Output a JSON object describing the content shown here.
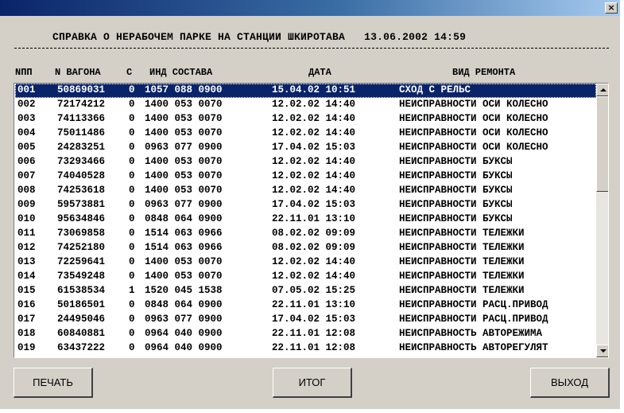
{
  "window": {
    "close_symbol": "×"
  },
  "report": {
    "title": "СПРАВКА О НЕРАБОЧЕМ ПАРКЕ НА СТАНЦИИ ШКИРОТАВА",
    "date": "13.06.2002 14:59"
  },
  "columns": {
    "npp": "NПП",
    "wagon": "N ВАГОНА",
    "c": "С",
    "train": "ИНД СОСТАВА",
    "date": "ДАТА",
    "repair": "ВИД РЕМОНТА"
  },
  "rows": [
    {
      "npp": "001",
      "wagon": "50869031",
      "c": "0",
      "train": "1057 088 0900",
      "date": "15.04.02 10:51",
      "repair": "СХОД С РЕЛЬС",
      "selected": true
    },
    {
      "npp": "002",
      "wagon": "72174212",
      "c": "0",
      "train": "1400 053 0070",
      "date": "12.02.02 14:40",
      "repair": "НЕИСПРАВНОСТИ ОСИ КОЛЕСНО"
    },
    {
      "npp": "003",
      "wagon": "74113366",
      "c": "0",
      "train": "1400 053 0070",
      "date": "12.02.02 14:40",
      "repair": "НЕИСПРАВНОСТИ ОСИ КОЛЕСНО"
    },
    {
      "npp": "004",
      "wagon": "75011486",
      "c": "0",
      "train": "1400 053 0070",
      "date": "12.02.02 14:40",
      "repair": "НЕИСПРАВНОСТИ ОСИ КОЛЕСНО"
    },
    {
      "npp": "005",
      "wagon": "24283251",
      "c": "0",
      "train": "0963 077 0900",
      "date": "17.04.02 15:03",
      "repair": "НЕИСПРАВНОСТИ ОСИ КОЛЕСНО"
    },
    {
      "npp": "006",
      "wagon": "73293466",
      "c": "0",
      "train": "1400 053 0070",
      "date": "12.02.02 14:40",
      "repair": "НЕИСПРАВНОСТИ БУКСЫ"
    },
    {
      "npp": "007",
      "wagon": "74040528",
      "c": "0",
      "train": "1400 053 0070",
      "date": "12.02.02 14:40",
      "repair": "НЕИСПРАВНОСТИ БУКСЫ"
    },
    {
      "npp": "008",
      "wagon": "74253618",
      "c": "0",
      "train": "1400 053 0070",
      "date": "12.02.02 14:40",
      "repair": "НЕИСПРАВНОСТИ БУКСЫ"
    },
    {
      "npp": "009",
      "wagon": "59573881",
      "c": "0",
      "train": "0963 077 0900",
      "date": "17.04.02 15:03",
      "repair": "НЕИСПРАВНОСТИ БУКСЫ"
    },
    {
      "npp": "010",
      "wagon": "95634846",
      "c": "0",
      "train": "0848 064 0900",
      "date": "22.11.01 13:10",
      "repair": "НЕИСПРАВНОСТИ БУКСЫ"
    },
    {
      "npp": "011",
      "wagon": "73069858",
      "c": "0",
      "train": "1514 063 0966",
      "date": "08.02.02 09:09",
      "repair": "НЕИСПРАВНОСТИ ТЕЛЕЖКИ"
    },
    {
      "npp": "012",
      "wagon": "74252180",
      "c": "0",
      "train": "1514 063 0966",
      "date": "08.02.02 09:09",
      "repair": "НЕИСПРАВНОСТИ ТЕЛЕЖКИ"
    },
    {
      "npp": "013",
      "wagon": "72259641",
      "c": "0",
      "train": "1400 053 0070",
      "date": "12.02.02 14:40",
      "repair": "НЕИСПРАВНОСТИ ТЕЛЕЖКИ"
    },
    {
      "npp": "014",
      "wagon": "73549248",
      "c": "0",
      "train": "1400 053 0070",
      "date": "12.02.02 14:40",
      "repair": "НЕИСПРАВНОСТИ ТЕЛЕЖКИ"
    },
    {
      "npp": "015",
      "wagon": "61538534",
      "c": "1",
      "train": "1520 045 1538",
      "date": "07.05.02 15:25",
      "repair": "НЕИСПРАВНОСТИ ТЕЛЕЖКИ"
    },
    {
      "npp": "016",
      "wagon": "50186501",
      "c": "0",
      "train": "0848 064 0900",
      "date": "22.11.01 13:10",
      "repair": "НЕИСПРАВНОСТИ РАСЦ.ПРИВОД"
    },
    {
      "npp": "017",
      "wagon": "24495046",
      "c": "0",
      "train": "0963 077 0900",
      "date": "17.04.02 15:03",
      "repair": "НЕИСПРАВНОСТИ РАСЦ.ПРИВОД"
    },
    {
      "npp": "018",
      "wagon": "60840881",
      "c": "0",
      "train": "0964 040 0900",
      "date": "22.11.01 12:08",
      "repair": "НЕИСПРАВНОСТЬ АВТОРЕЖИМА"
    },
    {
      "npp": "019",
      "wagon": "63437222",
      "c": "0",
      "train": "0964 040 0900",
      "date": "22.11.01 12:08",
      "repair": "НЕИСПРАВНОСТЬ АВТОРЕГУЛЯТ"
    }
  ],
  "buttons": {
    "print": "ПЕЧАТЬ",
    "total": "ИТОГ",
    "exit": "ВЫХОД"
  }
}
